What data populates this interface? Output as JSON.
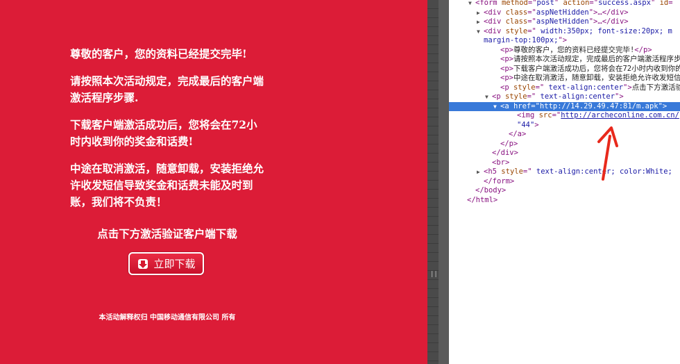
{
  "page": {
    "paragraphs": [
      "尊敬的客户，您的资料已经提交完毕!",
      "请按照本次活动规定，完成最后的客户端激活程序步骤.",
      "下载客户端激活成功后，您将会在72小时内收到你的奖金和话费!",
      "中途在取消激活，随意卸载，安装拒绝允许收发短信导致奖金和话费未能及时到账，我们将不负责！"
    ],
    "download_caption": "点击下方激活验证客户端下载",
    "download_button_label": "立即下载",
    "footer": "本活动解释权归 中国移动通信有限公司 所有",
    "colors": {
      "background": "#dc1c37",
      "text": "#ffffff",
      "selection": "#3879d9",
      "annotation": "#e8291c"
    }
  },
  "devtools": {
    "lines": [
      {
        "indent": 2,
        "tri": "▼",
        "parts": [
          [
            "tg",
            "<form "
          ],
          [
            "at",
            "method"
          ],
          [
            "tg",
            "=\""
          ],
          [
            "av",
            "post"
          ],
          [
            "tg",
            "\" "
          ],
          [
            "at",
            "action"
          ],
          [
            "tg",
            "=\""
          ],
          [
            "av",
            "success.aspx"
          ],
          [
            "tg",
            "\" "
          ],
          [
            "at",
            "id"
          ],
          [
            "tg",
            "="
          ]
        ]
      },
      {
        "indent": 3,
        "tri": "▶",
        "parts": [
          [
            "tg",
            "<div "
          ],
          [
            "at",
            "class"
          ],
          [
            "tg",
            "=\""
          ],
          [
            "av",
            "aspNetHidden"
          ],
          [
            "tg",
            "\">…</div>"
          ]
        ]
      },
      {
        "indent": 3,
        "tri": "▶",
        "parts": [
          [
            "tg",
            "<div "
          ],
          [
            "at",
            "class"
          ],
          [
            "tg",
            "=\""
          ],
          [
            "av",
            "aspNetHidden"
          ],
          [
            "tg",
            "\">…</div>"
          ]
        ]
      },
      {
        "indent": 3,
        "tri": "▼",
        "parts": [
          [
            "tg",
            "<div "
          ],
          [
            "at",
            "style"
          ],
          [
            "tg",
            "=\""
          ],
          [
            "av",
            " width:350px; font-size:20px; m"
          ]
        ]
      },
      {
        "indent": 3,
        "tri": "",
        "parts": [
          [
            "av",
            "margin-top:100px;"
          ],
          [
            "tg",
            "\">"
          ]
        ]
      },
      {
        "indent": 5,
        "tri": "",
        "parts": [
          [
            "tg",
            "<p>"
          ],
          [
            "tx",
            "尊敬的客户，您的资料已经提交完毕!"
          ],
          [
            "tg",
            "</p>"
          ]
        ]
      },
      {
        "indent": 5,
        "tri": "",
        "parts": [
          [
            "tg",
            "<p>"
          ],
          [
            "tx",
            "请按照本次活动规定，完成最后的客户端激活程序步"
          ]
        ]
      },
      {
        "indent": 5,
        "tri": "",
        "parts": [
          [
            "tg",
            "<p>"
          ],
          [
            "tx",
            "下载客户端激活成功后，您将会在72小时内收到你的"
          ]
        ]
      },
      {
        "indent": 5,
        "tri": "",
        "parts": [
          [
            "tg",
            "<p>"
          ],
          [
            "tx",
            "中途在取消激活，随意卸载，安装拒绝允许收发短信"
          ]
        ]
      },
      {
        "indent": 5,
        "tri": "",
        "parts": [
          [
            "tg",
            "<p "
          ],
          [
            "at",
            "style"
          ],
          [
            "tg",
            "=\""
          ],
          [
            "av",
            " text-align:center"
          ],
          [
            "tg",
            "\">"
          ],
          [
            "tx",
            "点击下方激活验"
          ]
        ]
      },
      {
        "indent": 4,
        "tri": "▼",
        "parts": [
          [
            "tg",
            "<p "
          ],
          [
            "at",
            "style"
          ],
          [
            "tg",
            "=\""
          ],
          [
            "av",
            " text-align:center"
          ],
          [
            "tg",
            "\">"
          ]
        ]
      },
      {
        "indent": 5,
        "tri": "▼",
        "selected": true,
        "parts": [
          [
            "tg",
            "<a "
          ],
          [
            "at",
            "href"
          ],
          [
            "tg",
            "=\""
          ],
          [
            "av",
            "http://14.29.49.47:81/m.apk"
          ],
          [
            "tg",
            "\">"
          ]
        ]
      },
      {
        "indent": 7,
        "tri": "",
        "parts": [
          [
            "tg",
            "<img "
          ],
          [
            "at",
            "src"
          ],
          [
            "tg",
            "=\""
          ],
          [
            "avu",
            "http://archeconline.com.cn/"
          ]
        ]
      },
      {
        "indent": 7,
        "tri": "",
        "parts": [
          [
            "av",
            "\"44\""
          ],
          [
            "tg",
            ">"
          ]
        ]
      },
      {
        "indent": 6,
        "tri": "",
        "parts": [
          [
            "tg",
            "</a>"
          ]
        ]
      },
      {
        "indent": 5,
        "tri": "",
        "parts": [
          [
            "tg",
            "</p>"
          ]
        ]
      },
      {
        "indent": 4,
        "tri": "",
        "parts": [
          [
            "tg",
            "</div>"
          ]
        ]
      },
      {
        "indent": 4,
        "tri": "",
        "parts": [
          [
            "tg",
            "<br>"
          ]
        ]
      },
      {
        "indent": 3,
        "tri": "▶",
        "parts": [
          [
            "tg",
            "<h5 "
          ],
          [
            "at",
            "style"
          ],
          [
            "tg",
            "=\""
          ],
          [
            "av",
            " text-align:center; color:White;"
          ]
        ]
      },
      {
        "indent": 3,
        "tri": "",
        "parts": [
          [
            "tg",
            "</form>"
          ]
        ]
      },
      {
        "indent": 2,
        "tri": "",
        "parts": [
          [
            "tg",
            "</body>"
          ]
        ]
      },
      {
        "indent": 1,
        "tri": "",
        "parts": [
          [
            "tg",
            "</html>"
          ]
        ]
      }
    ],
    "selected_marker": "•••"
  },
  "icons": {
    "download": "down-arrow-icon",
    "annotation": "red-arrow-annotation-icon",
    "splitter": "splitter-grip-icon"
  }
}
